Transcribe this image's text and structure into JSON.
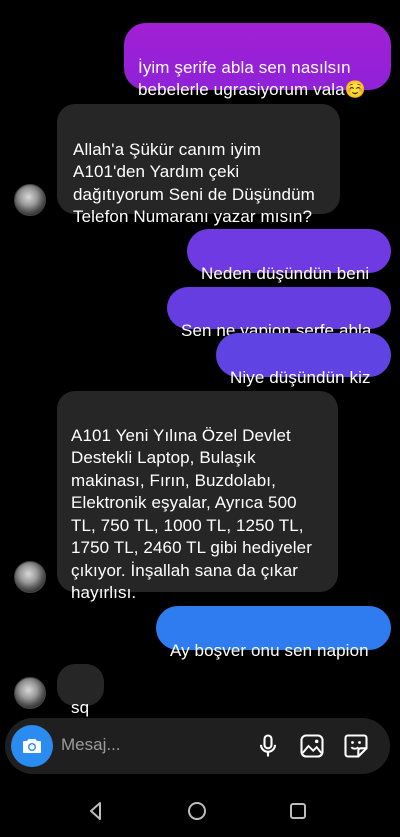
{
  "messages": [
    {
      "from": "me",
      "text": "İyim şerife abla sen nasılsın bebelerle ugrasiyorum vala☺️"
    },
    {
      "from": "them",
      "text": "Allah'a Şükür canım iyim A101'den Yardım çeki dağıtıyorum Seni de Düşündüm Telefon Numaranı yazar mısın?"
    },
    {
      "from": "me",
      "text": "Neden düşündün beni"
    },
    {
      "from": "me",
      "text": "Sen ne yapion serfe abla"
    },
    {
      "from": "me",
      "text": "Niye düşündün kiz"
    },
    {
      "from": "them",
      "text": "A101 Yeni Yılına Özel Devlet Destekli Laptop, Bulaşık makinası, Fırın, Buzdolabı, Elektronik eşyalar, Ayrıca  500 TL, 750 TL,  1000 TL, 1250 TL, 1750 TL, 2460 TL gibi hediyeler çıkıyor. İnşallah sana da çıkar hayırlısı."
    },
    {
      "from": "me",
      "text": "Ay boşver onu sen napion"
    },
    {
      "from": "them",
      "text": "sq"
    }
  ],
  "composer": {
    "placeholder": "Mesaj...",
    "icons": [
      "camera-icon",
      "microphone-icon",
      "gallery-icon",
      "sticker-icon"
    ]
  },
  "navbar": {
    "icons": [
      "back-icon",
      "home-icon",
      "recents-icon"
    ]
  },
  "colors": {
    "background": "#000000",
    "incoming_bubble": "#262626",
    "outgoing_purple": "#9b23d8",
    "outgoing_violet": "#6a3fe0",
    "outgoing_blue": "#2f7cf0",
    "camera_button": "#2a8cf0"
  }
}
